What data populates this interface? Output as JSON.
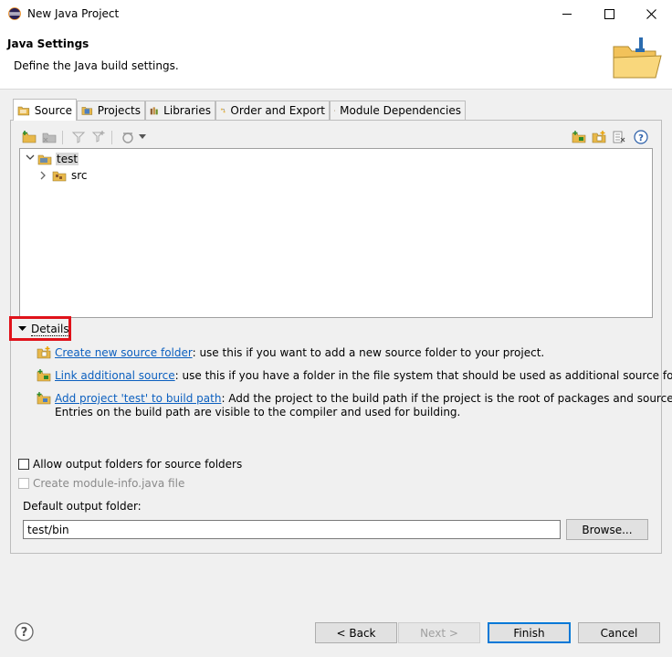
{
  "window": {
    "title": "New Java Project"
  },
  "header": {
    "title": "Java Settings",
    "subtitle": "Define the Java build settings."
  },
  "tabs": [
    {
      "label": "Source",
      "active": true
    },
    {
      "label": "Projects"
    },
    {
      "label": "Libraries"
    },
    {
      "label": "Order and Export"
    },
    {
      "label": "Module Dependencies"
    }
  ],
  "tree": {
    "root": "test",
    "children": [
      "src"
    ]
  },
  "details": {
    "toggle_label": "Details",
    "items": [
      {
        "link": "Create new source folder",
        "text": ": use this if you want to add a new source folder to your project."
      },
      {
        "link": "Link additional source",
        "text": ": use this if you have a folder in the file system that should be used as additional source folder."
      },
      {
        "link": "Add project 'test' to build path",
        "text": ": Add the project to the build path if the project is the root of packages and source files.",
        "text2": "Entries on the build path are visible to the compiler and used for building."
      }
    ]
  },
  "options": {
    "allow_output_label": "Allow output folders for source folders",
    "allow_output_checked": false,
    "module_info_label": "Create module-info.java file",
    "module_info_checked": false,
    "module_info_enabled": false
  },
  "output": {
    "label": "Default output folder:",
    "value": "test/bin",
    "browse_label": "Browse..."
  },
  "footer": {
    "back_label": "< Back",
    "next_label": "Next >",
    "finish_label": "Finish",
    "cancel_label": "Cancel"
  },
  "colors": {
    "link": "#0b5fbf",
    "highlight": "#e0121a",
    "accent": "#0078d7"
  }
}
